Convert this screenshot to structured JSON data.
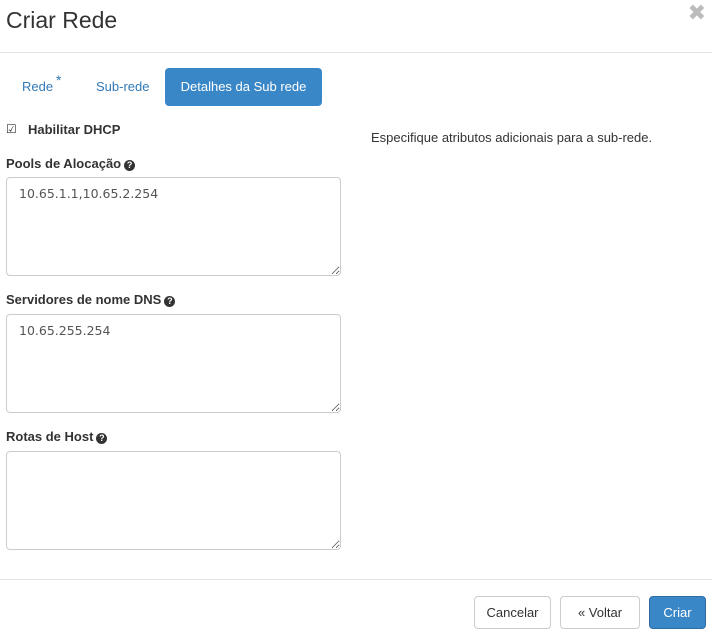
{
  "modal": {
    "title": "Criar Rede",
    "close_glyph": "✖"
  },
  "tabs": [
    {
      "label": "Rede",
      "required_marker": "*"
    },
    {
      "label": "Sub-rede"
    },
    {
      "label": "Detalhes da Sub rede",
      "active": true
    }
  ],
  "form": {
    "dhcp": {
      "label": "Habilitar DHCP",
      "checked": true,
      "glyph": "☑"
    },
    "pools": {
      "label": "Pools de Alocação",
      "value": "10.65.1.1,10.65.2.254"
    },
    "dns": {
      "label": "Servidores de nome DNS",
      "value": "10.65.255.254"
    },
    "routes": {
      "label": "Rotas de Host",
      "value": ""
    },
    "help_glyph": "?"
  },
  "help_text": "Especifique atributos adicionais para a sub-rede.",
  "footer": {
    "cancel_label": "Cancelar",
    "back_label": "« Voltar",
    "create_label": "Criar"
  },
  "colors": {
    "accent": "#3a87c7",
    "link": "#337ab7"
  }
}
